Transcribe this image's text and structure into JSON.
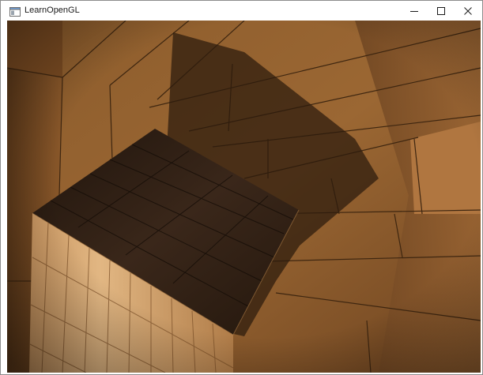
{
  "window": {
    "title": "LearnOpenGL",
    "controls": {
      "minimize_icon": "minimize-icon",
      "maximize_icon": "maximize-icon",
      "close_icon": "close-icon"
    }
  },
  "scene": {
    "description_icon": "opengl-render-viewport",
    "colors": {
      "wood_light": "#a8733c",
      "wood_mid": "#8a5a2b",
      "wood_dark": "#5a3718",
      "shadow": "#2b1a0c",
      "cube_top": "#2e1f14",
      "cube_side_light": "#d9ad78",
      "cube_side_mid": "#b88450",
      "window_border": "#8c8c8c"
    }
  }
}
